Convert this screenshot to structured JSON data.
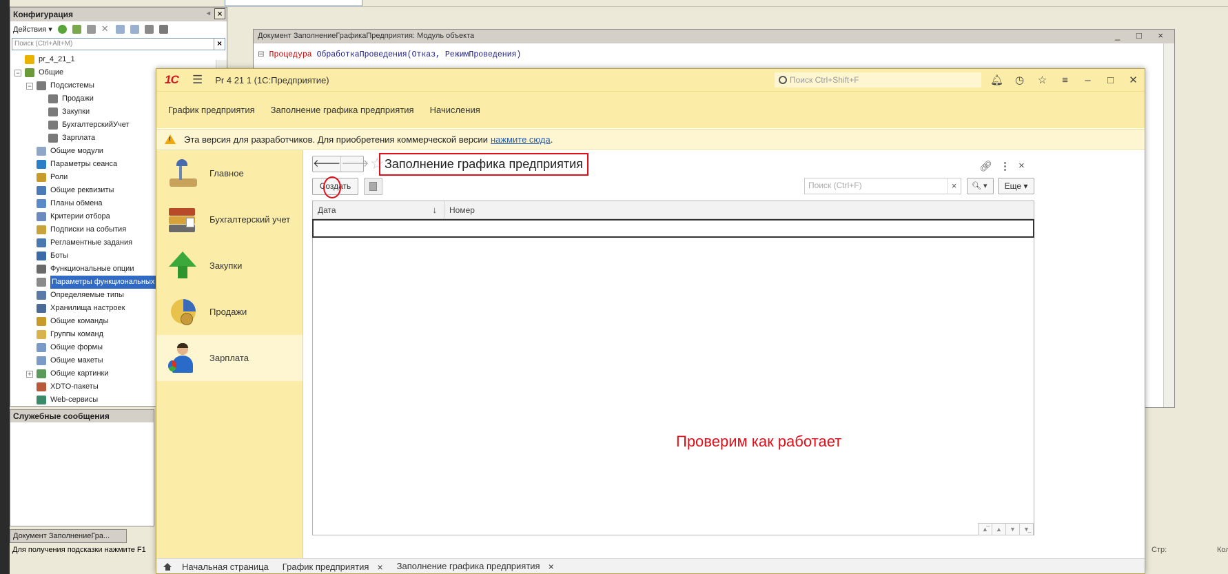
{
  "designer": {
    "config_panel": {
      "title": "Конфигурация",
      "actions_label": "Действия",
      "search_placeholder": "Поиск (Ctrl+Alt+M)",
      "tree": [
        {
          "label": "pr_4_21_1",
          "icon_color": "#e8b400",
          "level": 0,
          "expander": ""
        },
        {
          "label": "Общие",
          "icon_color": "#6a9a3a",
          "level": 0,
          "expander": "−"
        },
        {
          "label": "Подсистемы",
          "icon_color": "#7a7a7a",
          "level": 1,
          "expander": "−"
        },
        {
          "label": "Продажи",
          "icon_color": "#7a7a7a",
          "level": 2,
          "expander": ""
        },
        {
          "label": "Закупки",
          "icon_color": "#7a7a7a",
          "level": 2,
          "expander": ""
        },
        {
          "label": "БухгалтерскийУчет",
          "icon_color": "#7a7a7a",
          "level": 2,
          "expander": ""
        },
        {
          "label": "Зарплата",
          "icon_color": "#7a7a7a",
          "level": 2,
          "expander": ""
        },
        {
          "label": "Общие модули",
          "icon_color": "#8fa6c8",
          "level": 1,
          "expander": ""
        },
        {
          "label": "Параметры сеанса",
          "icon_color": "#2a7fc8",
          "level": 1,
          "expander": ""
        },
        {
          "label": "Роли",
          "icon_color": "#c89a2a",
          "level": 1,
          "expander": ""
        },
        {
          "label": "Общие реквизиты",
          "icon_color": "#4a7ab8",
          "level": 1,
          "expander": ""
        },
        {
          "label": "Планы обмена",
          "icon_color": "#5a8ac8",
          "level": 1,
          "expander": ""
        },
        {
          "label": "Критерии отбора",
          "icon_color": "#6a8ac0",
          "level": 1,
          "expander": ""
        },
        {
          "label": "Подписки на события",
          "icon_color": "#c8a23a",
          "level": 1,
          "expander": ""
        },
        {
          "label": "Регламентные задания",
          "icon_color": "#4a78b0",
          "level": 1,
          "expander": ""
        },
        {
          "label": "Боты",
          "icon_color": "#3a6aa8",
          "level": 1,
          "expander": ""
        },
        {
          "label": "Функциональные опции",
          "icon_color": "#6a6a6a",
          "level": 1,
          "expander": ""
        },
        {
          "label": "Параметры функциональных",
          "icon_color": "#8a8a8a",
          "level": 1,
          "expander": "",
          "selected": true
        },
        {
          "label": "Определяемые типы",
          "icon_color": "#5a7aa8",
          "level": 1,
          "expander": ""
        },
        {
          "label": "Хранилища настроек",
          "icon_color": "#4a6a98",
          "level": 1,
          "expander": ""
        },
        {
          "label": "Общие команды",
          "icon_color": "#c89a2a",
          "level": 1,
          "expander": ""
        },
        {
          "label": "Группы команд",
          "icon_color": "#d8b24a",
          "level": 1,
          "expander": ""
        },
        {
          "label": "Общие формы",
          "icon_color": "#7a9ac8",
          "level": 1,
          "expander": ""
        },
        {
          "label": "Общие макеты",
          "icon_color": "#7a9ac8",
          "level": 1,
          "expander": ""
        },
        {
          "label": "Общие картинки",
          "icon_color": "#5a9a5a",
          "level": 1,
          "expander": "+"
        },
        {
          "label": "XDTO-пакеты",
          "icon_color": "#b85a3a",
          "level": 1,
          "expander": ""
        },
        {
          "label": "Web-сервисы",
          "icon_color": "#3a8a6a",
          "level": 1,
          "expander": ""
        }
      ]
    },
    "messages_title": "Служебные сообщения",
    "taskbar_tab": "Документ ЗаполнениеГра...",
    "status_hint": "Для получения подсказки нажмите F1",
    "status_row": "Стр:",
    "status_col": "Кол:",
    "module": {
      "title": "Документ ЗаполнениеГрафикаПредприятия: Модуль объекта",
      "code_keyword": "Процедура",
      "code_rest": "ОбработкаПроведения(Отказ, РежимПроведения)"
    }
  },
  "client": {
    "logo": "1С",
    "title": "Pr 4 21 1  (1С:Предприятие)",
    "search_placeholder": "Поиск Ctrl+Shift+F",
    "sections": [
      "График предприятия",
      "Заполнение графика предприятия",
      "Начисления"
    ],
    "warning": {
      "text": "Эта версия для разработчиков. Для приобретения коммерческой версии",
      "link": "нажмите сюда",
      "tail": "."
    },
    "sidebar": [
      {
        "label": "Главное",
        "icon": "lamp-icon"
      },
      {
        "label": "Бухгалтерский учет",
        "icon": "binders-icon"
      },
      {
        "label": "Закупки",
        "icon": "green-arrow-up-icon"
      },
      {
        "label": "Продажи",
        "icon": "pie-coins-icon"
      },
      {
        "label": "Зарплата",
        "icon": "person-icon",
        "active": true
      }
    ],
    "form": {
      "title": "Заполнение графика предприятия",
      "create_label": "Создать",
      "search_placeholder": "Поиск (Ctrl+F)",
      "more_label": "Еще",
      "columns": [
        "Дата",
        "Номер"
      ],
      "sort_indicator": "↓"
    },
    "overlay_text": "Проверим как работает",
    "open_tabs": [
      {
        "label": "Начальная страница",
        "home": true
      },
      {
        "label": "График предприятия",
        "closable": true
      },
      {
        "label": "Заполнение графика предприятия",
        "closable": true,
        "active": true
      }
    ]
  },
  "colors": {
    "accent_red": "#e0101a",
    "panel_yellow": "#fbeda7",
    "active_tab_green": "#3aa33a"
  }
}
